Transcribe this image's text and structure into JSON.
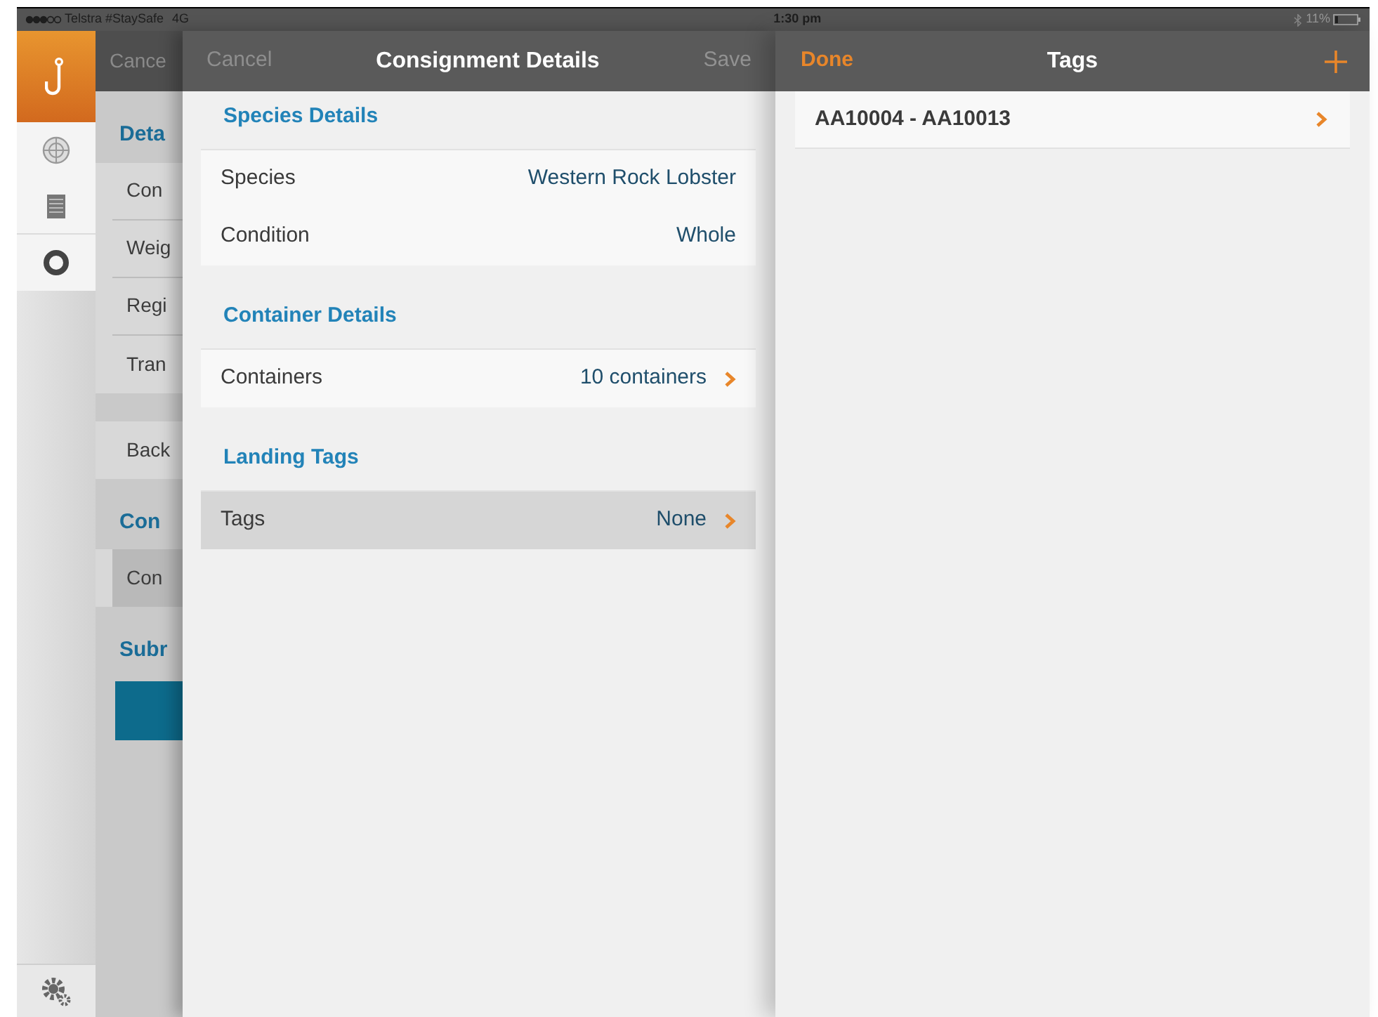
{
  "status_bar": {
    "carrier": "Telstra #StaySafe",
    "network": "4G",
    "time": "1:30 pm",
    "battery": "11%"
  },
  "back_panel": {
    "nav_left": "Cance",
    "sections": [
      {
        "header": "Deta",
        "rows": [
          {
            "label": "Con",
            "selected": false
          },
          {
            "label": "Weig",
            "selected": false
          },
          {
            "label": "Regi",
            "selected": false
          },
          {
            "label": "Tran",
            "selected": false
          }
        ]
      },
      {
        "rows": [
          {
            "label": "Back",
            "selected": false
          }
        ]
      },
      {
        "header": "Con",
        "rows": [
          {
            "label": "Con",
            "selected": true
          }
        ]
      },
      {
        "header": "Subr",
        "kind": "button"
      }
    ]
  },
  "details_panel": {
    "nav": {
      "left": "Cancel",
      "title": "Consignment Details",
      "right": "Save"
    },
    "sections": [
      {
        "header": "Species Details",
        "rows": [
          {
            "label": "Species",
            "value": "Western Rock Lobster",
            "disclosure": false,
            "selected": false
          },
          {
            "label": "Condition",
            "value": "Whole",
            "disclosure": false,
            "selected": false
          }
        ]
      },
      {
        "header": "Container Details",
        "rows": [
          {
            "label": "Containers",
            "value": "10 containers",
            "disclosure": true,
            "selected": false
          }
        ]
      },
      {
        "header": "Landing Tags",
        "rows": [
          {
            "label": "Tags",
            "value": "None",
            "disclosure": true,
            "selected": true
          }
        ]
      }
    ]
  },
  "tags_panel": {
    "nav": {
      "left": "Done",
      "title": "Tags"
    },
    "rows": [
      {
        "label": "AA10004 - AA10013",
        "disclosure": true
      }
    ]
  }
}
